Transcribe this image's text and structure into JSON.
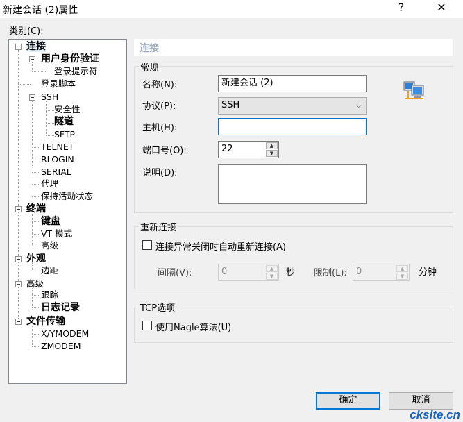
{
  "window": {
    "title": "新建会话 (2)属性",
    "help_glyph": "?",
    "close_glyph": "✕"
  },
  "category_label": "类别(C):",
  "tree": {
    "connection": "连接",
    "auth": "用户身份验证",
    "login_prompts": "登录提示符",
    "login_script": "登录脚本",
    "ssh": "SSH",
    "security": "安全性",
    "tunnel": "隧道",
    "sftp": "SFTP",
    "telnet": "TELNET",
    "rlogin": "RLOGIN",
    "serial": "SERIAL",
    "proxy": "代理",
    "keepalive": "保持活动状态",
    "terminal": "终端",
    "keyboard": "键盘",
    "vt_mode": "VT 模式",
    "advanced_term": "高级",
    "appearance": "外观",
    "margin": "边距",
    "advanced": "高级",
    "trace": "跟踪",
    "logging": "日志记录",
    "file_transfer": "文件传输",
    "xymodem": "X/YMODEM",
    "zmodem": "ZMODEM"
  },
  "panel_title": "连接",
  "general": {
    "title": "常规",
    "name_label": "名称(N):",
    "name_value": "新建会话 (2)",
    "protocol_label": "协议(P):",
    "protocol_value": "SSH",
    "host_label": "主机(H):",
    "host_value": "",
    "port_label": "端口号(O):",
    "port_value": "22",
    "desc_label": "说明(D):",
    "desc_value": "",
    "icon": "network-computer-icon"
  },
  "reconnect": {
    "title": "重新连接",
    "checkbox_label": "连接异常关闭时自动重新连接(A)",
    "interval_label": "间隔(V):",
    "interval_value": "0",
    "interval_unit": "秒",
    "limit_label": "限制(L):",
    "limit_value": "0",
    "limit_unit": "分钟"
  },
  "tcp": {
    "title": "TCP选项",
    "nagle_label": "使用Nagle算法(U)"
  },
  "buttons": {
    "ok": "确定",
    "cancel": "取消"
  },
  "watermark": "cksite.cn",
  "colors": {
    "accent": "#0078d7",
    "panel_header_text": "#9aa6b6",
    "tree_selection": "#e5f3ff"
  }
}
